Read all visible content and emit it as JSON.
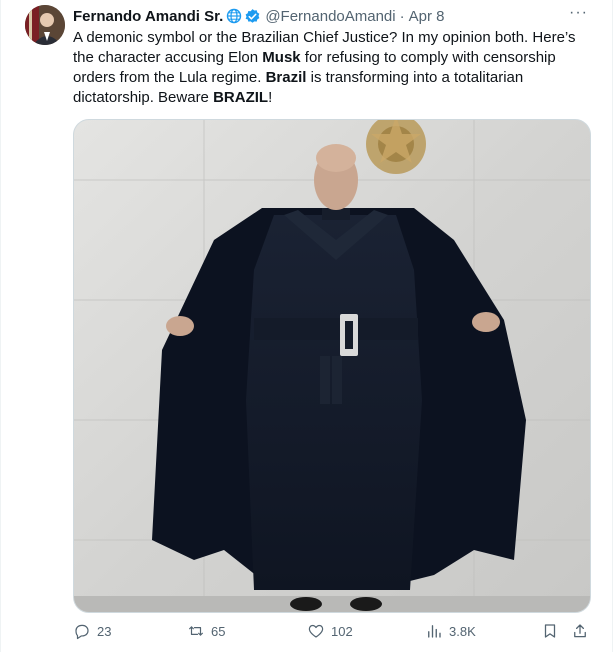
{
  "tweet": {
    "author_name": "Fernando Amandi Sr.",
    "handle": "@FernandoAmandi",
    "separator": "·",
    "date": "Apr 8",
    "more": "···",
    "text": {
      "p1": "A demonic symbol or the Brazilian Chief Justice? In my opinion both. Here’s the character accusing Elon ",
      "b1": "Musk",
      "p2": " for refusing to comply with censorship orders from the Lula regime. ",
      "b2": "Brazil",
      "p3": " is transforming into a totalitarian dictatorship. Beware ",
      "b3": "BRAZIL",
      "p4": "!"
    },
    "stats": {
      "replies": "23",
      "reposts": "65",
      "likes": "102",
      "views": "3.8K"
    },
    "accent_color": "#1d9bf0"
  }
}
